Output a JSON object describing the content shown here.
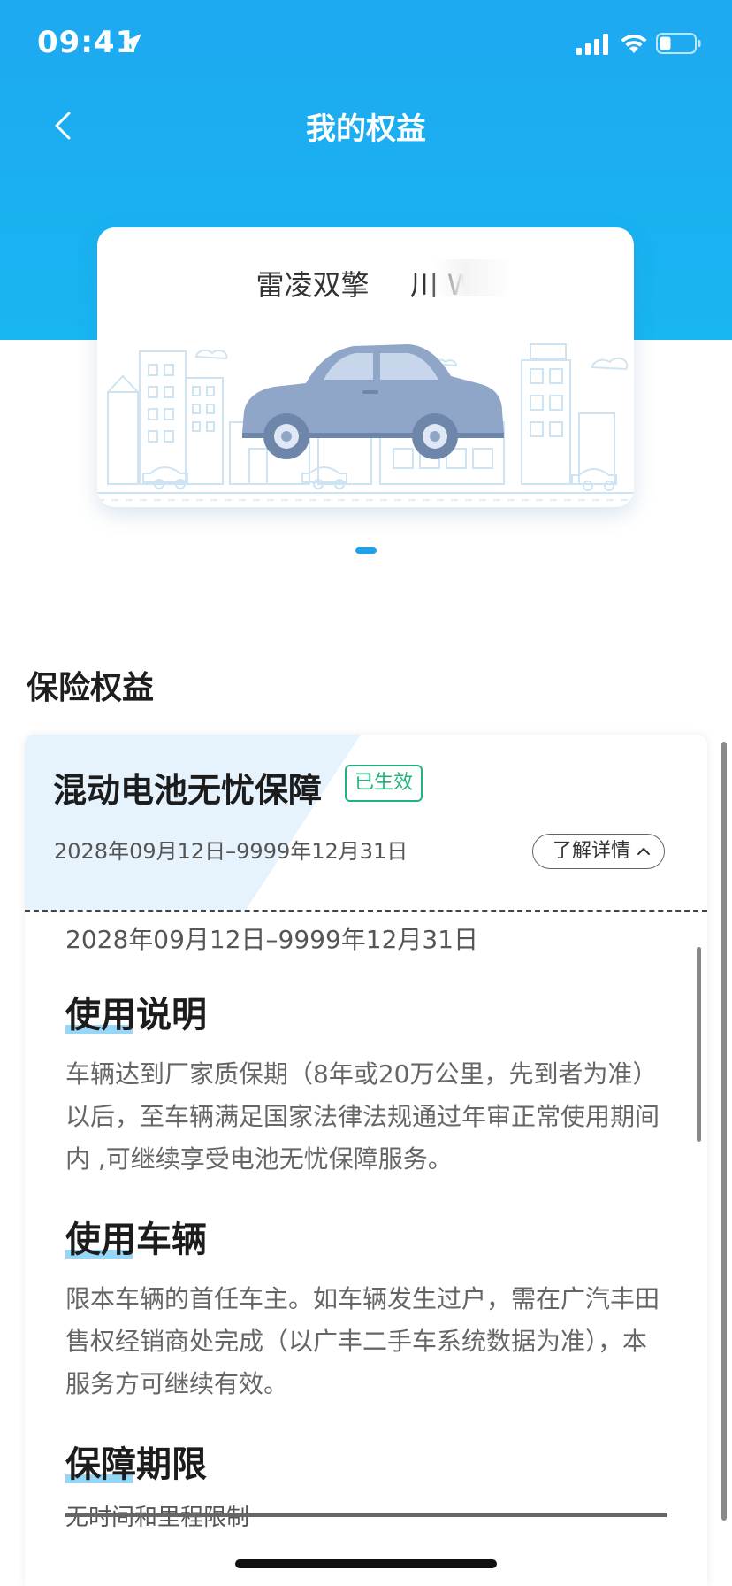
{
  "status_bar": {
    "time": "09:41"
  },
  "nav": {
    "title": "我的权益"
  },
  "car_card": {
    "model": "雷凌双擎",
    "plate": "川 W"
  },
  "insurance": {
    "section_title": "保险权益",
    "benefit": {
      "name": "混动电池无忧保障",
      "status": "已生效",
      "period": "2028年09月12日–9999年12月31日",
      "details_button": "了解详情"
    },
    "details": {
      "period": "2028年09月12日–9999年12月31日",
      "sections": [
        {
          "heading": "使用说明",
          "text": "车辆达到厂家质保期（8年或20万公里，先到者为准）以后，至车辆满足国家法律法规通过年审正常使用期间内 ,可继续享受电池无忧保障服务。"
        },
        {
          "heading": "使用车辆",
          "text": "限本车辆的首任车主。如车辆发生过户，需在广汽丰田售权经销商处完成（以广丰二手车系统数据为准），本服务方可继续有效。"
        },
        {
          "heading": "保障期限",
          "text": "无时间和里程限制"
        }
      ]
    }
  },
  "colors": {
    "header": "#1ea8f0",
    "status_green": "#22b37a",
    "accent_highlight": "#5ec2f5"
  }
}
